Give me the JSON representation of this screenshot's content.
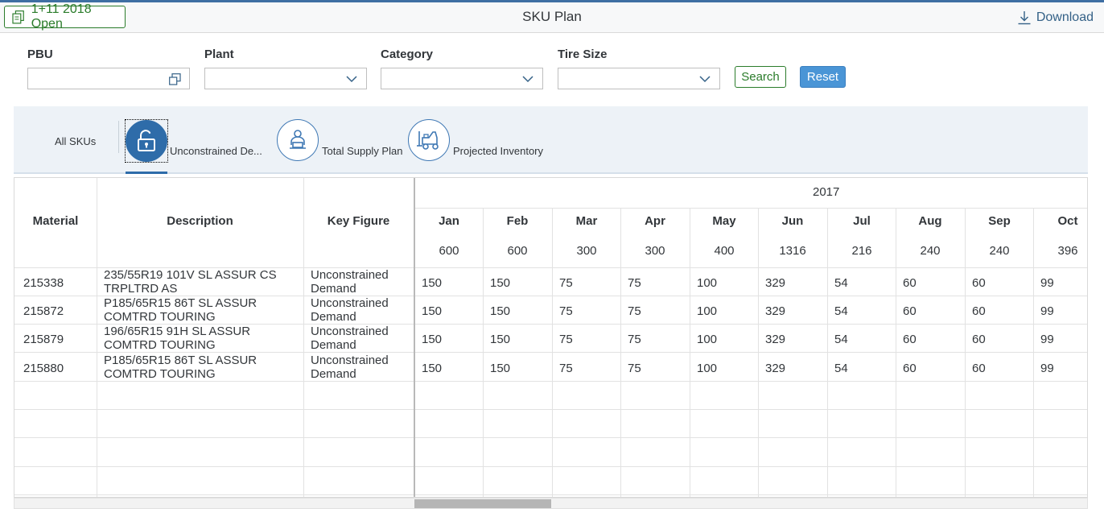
{
  "header": {
    "open_label": "1+11 2018 Open",
    "title": "SKU Plan",
    "download_label": "Download"
  },
  "filters": {
    "pbu_label": "PBU",
    "plant_label": "Plant",
    "category_label": "Category",
    "tire_size_label": "Tire Size",
    "pbu_value": "",
    "plant_value": "",
    "category_value": "",
    "tire_size_value": "",
    "search_label": "Search",
    "reset_label": "Reset"
  },
  "tabs": {
    "all": "All SKUs",
    "unconstrained": "Unconstrained De...",
    "supply": "Total Supply Plan",
    "inventory": "Projected Inventory",
    "icons": [
      "unlock-icon",
      "person-workstation-icon",
      "forklift-icon"
    ]
  },
  "table": {
    "headers": {
      "material": "Material",
      "description": "Description",
      "key_figure": "Key Figure"
    },
    "year": "2017",
    "months": [
      "Jan",
      "Feb",
      "Mar",
      "Apr",
      "May",
      "Jun",
      "Jul",
      "Aug",
      "Sep",
      "Oct"
    ],
    "totals": [
      "600",
      "600",
      "300",
      "300",
      "400",
      "1316",
      "216",
      "240",
      "240",
      "396"
    ],
    "rows": [
      {
        "material": "215338",
        "desc1": "235/55R19 101V SL ASSUR CS",
        "desc2": "TRPLTRD AS",
        "kf1": "Unconstrained",
        "kf2": "Demand",
        "values": [
          "150",
          "150",
          "75",
          "75",
          "100",
          "329",
          "54",
          "60",
          "60",
          "99"
        ]
      },
      {
        "material": "215872",
        "desc1": "P185/65R15 86T SL ASSUR",
        "desc2": "COMTRD TOURING",
        "kf1": "Unconstrained",
        "kf2": "Demand",
        "values": [
          "150",
          "150",
          "75",
          "75",
          "100",
          "329",
          "54",
          "60",
          "60",
          "99"
        ]
      },
      {
        "material": "215879",
        "desc1": "196/65R15 91H SL ASSUR",
        "desc2": "COMTRD TOURING",
        "kf1": "Unconstrained",
        "kf2": "Demand",
        "values": [
          "150",
          "150",
          "75",
          "75",
          "100",
          "329",
          "54",
          "60",
          "60",
          "99"
        ]
      },
      {
        "material": "215880",
        "desc1": "P185/65R15 86T SL ASSUR",
        "desc2": "COMTRD TOURING",
        "kf1": "Unconstrained",
        "kf2": "Demand",
        "values": [
          "150",
          "150",
          "75",
          "75",
          "100",
          "329",
          "54",
          "60",
          "60",
          "99"
        ]
      }
    ]
  },
  "colors": {
    "accent": "#2e6ca9",
    "positive": "#2b7c2b",
    "reset": "#4a95d6"
  }
}
